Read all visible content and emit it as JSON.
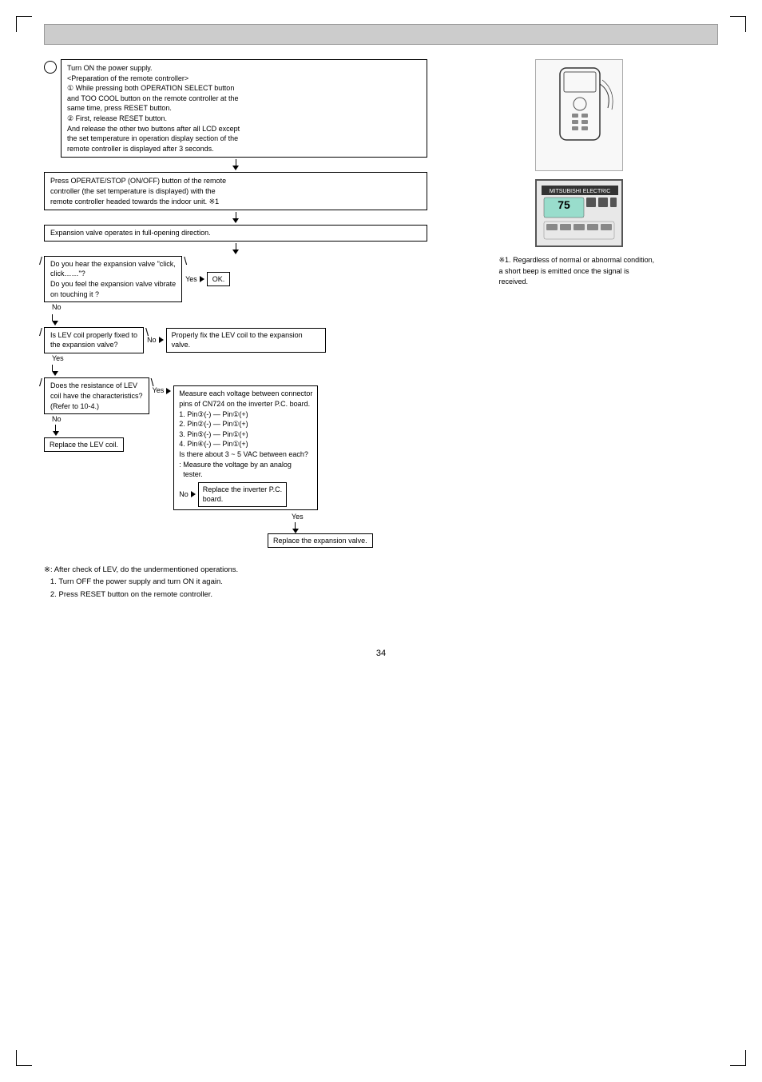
{
  "page": {
    "number": "34",
    "header_bar": "",
    "corner_marks": true
  },
  "flowchart": {
    "start_label": "○",
    "step1": {
      "title": "Turn ON the power supply.",
      "lines": [
        "<Preparation of the remote controller>",
        "① While pressing both OPERATION SELECT button",
        "and TOO COOL button on the remote controller at the",
        "same time, press RESET button.",
        "② First, release RESET button.",
        "And release the other two buttons after all LCD except",
        "the set temperature in operation display section of the",
        "remote controller is displayed after 3 seconds."
      ]
    },
    "step2": {
      "lines": [
        "Press OPERATE/STOP (ON/OFF) button of the remote",
        "controller (the set temperature is displayed) with the",
        "remote controller headed towards the indoor unit. ※1"
      ]
    },
    "step3": "Expansion valve operates in full-opening direction.",
    "decision1": {
      "lines": [
        "Do you hear the expansion valve \"click,",
        "click……\"?",
        "Do you feel the expansion valve vibrate",
        "on touching it ?"
      ],
      "yes_label": "Yes",
      "no_label": "No",
      "yes_result": "OK."
    },
    "decision2": {
      "lines": [
        "Is LEV coil properly fixed to",
        "the expansion valve?"
      ],
      "no_label": "No",
      "yes_label": "Yes",
      "no_result": "Properly fix the LEV coil to the expansion valve."
    },
    "decision3": {
      "lines": [
        "Does the resistance of LEV",
        "coil have the characteristics?",
        "(Refer to 10-4.)"
      ],
      "yes_label": "Yes",
      "no_label": "No",
      "no_result": "Replace the LEV coil."
    },
    "measure_box": {
      "lines": [
        "Measure each voltage between connector",
        "pins of CN724 on the inverter P.C. board.",
        "1. Pin③(-) — Pin①(+)",
        "2. Pin②(-) — Pin①(+)",
        "3. Pin⑤(-) — Pin①(+)",
        "4. Pin④(-) — Pin①(+)",
        "Is there about 3 ~ 5 VAC between each?",
        ": Measure the voltage by an analog",
        "  tester."
      ]
    },
    "measure_no_result": {
      "lines": [
        "Replace the inverter P.C.",
        "board."
      ]
    },
    "measure_yes_result": "Replace the expansion valve.",
    "measure_yes_label": "Yes",
    "measure_no_label": "No"
  },
  "note1": {
    "symbol": "※1.",
    "text": "Regardless of normal or abnormal condition, a short beep is emitted once the signal is received."
  },
  "footer": {
    "symbol": "※",
    "lines": [
      ": After check of LEV, do the undermentioned operations.",
      "1. Turn OFF the power supply and turn ON it again.",
      "2. Press RESET button on the remote controller."
    ]
  },
  "remote_controller_svg": "remote",
  "display_unit_svg": "display"
}
